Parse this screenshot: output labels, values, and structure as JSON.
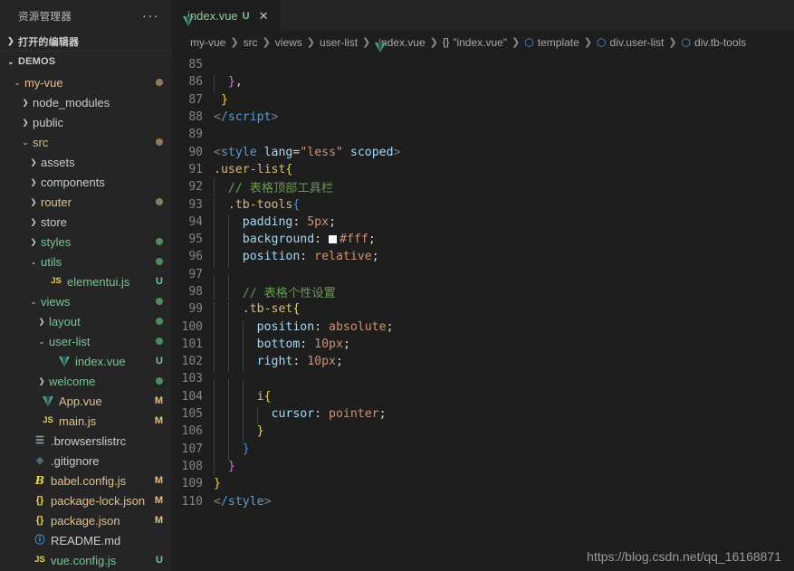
{
  "sidebar": {
    "title": "资源管理器",
    "more_label": "···",
    "sections": [
      {
        "label": "打开的编辑器",
        "expanded": false
      },
      {
        "label": "DEMOS",
        "expanded": true
      }
    ],
    "tree": [
      {
        "indent": 1,
        "chev": "v",
        "icon": "folder",
        "label": "my-vue",
        "badge": "",
        "dot": "modified",
        "color": "modified"
      },
      {
        "indent": 2,
        "chev": ">",
        "icon": "folder",
        "label": "node_modules",
        "badge": "",
        "dot": "",
        "color": "plain"
      },
      {
        "indent": 2,
        "chev": ">",
        "icon": "folder",
        "label": "public",
        "badge": "",
        "dot": "",
        "color": "plain"
      },
      {
        "indent": 2,
        "chev": "v",
        "icon": "folder",
        "label": "src",
        "badge": "",
        "dot": "modified",
        "color": "modified"
      },
      {
        "indent": 3,
        "chev": ">",
        "icon": "folder",
        "label": "assets",
        "badge": "",
        "dot": "",
        "color": "plain"
      },
      {
        "indent": 3,
        "chev": ">",
        "icon": "folder",
        "label": "components",
        "badge": "",
        "dot": "",
        "color": "plain"
      },
      {
        "indent": 3,
        "chev": ">",
        "icon": "folder",
        "label": "router",
        "badge": "",
        "dot": "modified",
        "color": "modified"
      },
      {
        "indent": 3,
        "chev": ">",
        "icon": "folder",
        "label": "store",
        "badge": "",
        "dot": "",
        "color": "plain"
      },
      {
        "indent": 3,
        "chev": ">",
        "icon": "folder",
        "label": "styles",
        "badge": "",
        "dot": "untracked",
        "color": "untracked"
      },
      {
        "indent": 3,
        "chev": "v",
        "icon": "folder",
        "label": "utils",
        "badge": "",
        "dot": "untracked",
        "color": "untracked"
      },
      {
        "indent": 4,
        "chev": "",
        "icon": "js",
        "label": "elementui.js",
        "badge": "U",
        "dot": "",
        "color": "untracked"
      },
      {
        "indent": 3,
        "chev": "v",
        "icon": "folder",
        "label": "views",
        "badge": "",
        "dot": "untracked",
        "color": "untracked"
      },
      {
        "indent": 4,
        "chev": ">",
        "icon": "folder",
        "label": "layout",
        "badge": "",
        "dot": "untracked",
        "color": "untracked"
      },
      {
        "indent": 4,
        "chev": "v",
        "icon": "folder",
        "label": "user-list",
        "badge": "",
        "dot": "untracked",
        "color": "untracked"
      },
      {
        "indent": 5,
        "chev": "",
        "icon": "vue",
        "label": "index.vue",
        "badge": "U",
        "dot": "",
        "color": "untracked"
      },
      {
        "indent": 4,
        "chev": ">",
        "icon": "folder",
        "label": "welcome",
        "badge": "",
        "dot": "untracked",
        "color": "untracked"
      },
      {
        "indent": 3,
        "chev": "",
        "icon": "vue",
        "label": "App.vue",
        "badge": "M",
        "dot": "",
        "color": "modified"
      },
      {
        "indent": 3,
        "chev": "",
        "icon": "js",
        "label": "main.js",
        "badge": "M",
        "dot": "",
        "color": "modified"
      },
      {
        "indent": 2,
        "chev": "",
        "icon": "list",
        "label": ".browserslistrc",
        "badge": "",
        "dot": "",
        "color": "plain"
      },
      {
        "indent": 2,
        "chev": "",
        "icon": "git",
        "label": ".gitignore",
        "badge": "",
        "dot": "",
        "color": "plain"
      },
      {
        "indent": 2,
        "chev": "",
        "icon": "babel",
        "label": "babel.config.js",
        "badge": "M",
        "dot": "",
        "color": "modified"
      },
      {
        "indent": 2,
        "chev": "",
        "icon": "json",
        "label": "package-lock.json",
        "badge": "M",
        "dot": "",
        "color": "modified"
      },
      {
        "indent": 2,
        "chev": "",
        "icon": "json",
        "label": "package.json",
        "badge": "M",
        "dot": "",
        "color": "modified"
      },
      {
        "indent": 2,
        "chev": "",
        "icon": "info",
        "label": "README.md",
        "badge": "",
        "dot": "",
        "color": "plain"
      },
      {
        "indent": 2,
        "chev": "",
        "icon": "js",
        "label": "vue.config.js",
        "badge": "U",
        "dot": "",
        "color": "untracked"
      }
    ]
  },
  "tab": {
    "icon": "vue-icon",
    "label": "index.vue",
    "status_badge": "U",
    "close_label": "✕"
  },
  "breadcrumb": [
    {
      "text": "my-vue",
      "icon": ""
    },
    {
      "text": "src",
      "icon": ""
    },
    {
      "text": "views",
      "icon": ""
    },
    {
      "text": "user-list",
      "icon": ""
    },
    {
      "text": "index.vue",
      "icon": "vue"
    },
    {
      "text": "\"index.vue\"",
      "icon": "braces"
    },
    {
      "text": "template",
      "icon": "cube"
    },
    {
      "text": "div.user-list",
      "icon": "cube"
    },
    {
      "text": "div.tb-tools",
      "icon": "cube"
    }
  ],
  "editor": {
    "first_line": 85,
    "lines": [
      {
        "n": 85,
        "indent": 0,
        "guides": [],
        "tokens": []
      },
      {
        "n": 86,
        "indent": 0,
        "guides": [
          1
        ],
        "tokens": [
          {
            "t": "  ",
            "c": "t-punc"
          },
          {
            "t": "}",
            "c": "b2"
          },
          {
            "t": ",",
            "c": "t-punc"
          }
        ]
      },
      {
        "n": 87,
        "indent": 0,
        "guides": [],
        "tokens": [
          {
            "t": " ",
            "c": "t-punc"
          },
          {
            "t": "}",
            "c": "b1"
          }
        ]
      },
      {
        "n": 88,
        "indent": 0,
        "guides": [],
        "tokens": [
          {
            "t": "<",
            "c": "t-brk"
          },
          {
            "t": "/script",
            "c": "t-tag"
          },
          {
            "t": ">",
            "c": "t-brk"
          }
        ]
      },
      {
        "n": 89,
        "indent": 0,
        "guides": [],
        "tokens": []
      },
      {
        "n": 90,
        "indent": 0,
        "guides": [],
        "tokens": [
          {
            "t": "<",
            "c": "t-brk"
          },
          {
            "t": "style",
            "c": "t-tag"
          },
          {
            "t": " ",
            "c": "t-punc"
          },
          {
            "t": "lang",
            "c": "t-attr"
          },
          {
            "t": "=",
            "c": "t-punc"
          },
          {
            "t": "\"less\"",
            "c": "t-str"
          },
          {
            "t": " ",
            "c": "t-punc"
          },
          {
            "t": "scoped",
            "c": "t-attr"
          },
          {
            "t": ">",
            "c": "t-brk"
          }
        ]
      },
      {
        "n": 91,
        "indent": 0,
        "guides": [],
        "tokens": [
          {
            "t": ".user-list",
            "c": "t-sel"
          },
          {
            "t": "{",
            "c": "b1"
          }
        ]
      },
      {
        "n": 92,
        "indent": 0,
        "guides": [
          1
        ],
        "tokens": [
          {
            "t": "  // 表格顶部工具栏",
            "c": "t-com"
          }
        ]
      },
      {
        "n": 93,
        "indent": 0,
        "guides": [
          1
        ],
        "tokens": [
          {
            "t": "  .tb-tools",
            "c": "t-sel"
          },
          {
            "t": "{",
            "c": "b3"
          }
        ]
      },
      {
        "n": 94,
        "indent": 0,
        "guides": [
          1,
          2
        ],
        "tokens": [
          {
            "t": "    padding",
            "c": "t-prop"
          },
          {
            "t": ": ",
            "c": "t-punc"
          },
          {
            "t": "5px",
            "c": "t-val"
          },
          {
            "t": ";",
            "c": "t-punc"
          }
        ]
      },
      {
        "n": 95,
        "indent": 0,
        "guides": [
          1,
          2
        ],
        "tokens": [
          {
            "t": "    background",
            "c": "t-prop"
          },
          {
            "t": ": ",
            "c": "t-punc"
          },
          {
            "t": "§#fff",
            "c": "t-val"
          },
          {
            "t": ";",
            "c": "t-punc"
          }
        ]
      },
      {
        "n": 96,
        "indent": 0,
        "guides": [
          1,
          2
        ],
        "tokens": [
          {
            "t": "    position",
            "c": "t-prop"
          },
          {
            "t": ": ",
            "c": "t-punc"
          },
          {
            "t": "relative",
            "c": "t-val"
          },
          {
            "t": ";",
            "c": "t-punc"
          }
        ]
      },
      {
        "n": 97,
        "indent": 0,
        "guides": [
          1,
          2
        ],
        "tokens": []
      },
      {
        "n": 98,
        "indent": 0,
        "guides": [
          1,
          2
        ],
        "tokens": [
          {
            "t": "    // 表格个性设置",
            "c": "t-com"
          }
        ]
      },
      {
        "n": 99,
        "indent": 0,
        "guides": [
          1,
          2
        ],
        "tokens": [
          {
            "t": "    .tb-set",
            "c": "t-sel"
          },
          {
            "t": "{",
            "c": "b1"
          }
        ]
      },
      {
        "n": 100,
        "indent": 0,
        "guides": [
          1,
          2,
          3
        ],
        "tokens": [
          {
            "t": "      position",
            "c": "t-prop"
          },
          {
            "t": ": ",
            "c": "t-punc"
          },
          {
            "t": "absolute",
            "c": "t-val"
          },
          {
            "t": ";",
            "c": "t-punc"
          }
        ]
      },
      {
        "n": 101,
        "indent": 0,
        "guides": [
          1,
          2,
          3
        ],
        "tokens": [
          {
            "t": "      bottom",
            "c": "t-prop"
          },
          {
            "t": ": ",
            "c": "t-punc"
          },
          {
            "t": "10px",
            "c": "t-val"
          },
          {
            "t": ";",
            "c": "t-punc"
          }
        ]
      },
      {
        "n": 102,
        "indent": 0,
        "guides": [
          1,
          2,
          3
        ],
        "tokens": [
          {
            "t": "      right",
            "c": "t-prop"
          },
          {
            "t": ": ",
            "c": "t-punc"
          },
          {
            "t": "10px",
            "c": "t-val"
          },
          {
            "t": ";",
            "c": "t-punc"
          }
        ]
      },
      {
        "n": 103,
        "indent": 0,
        "guides": [
          1,
          2,
          3
        ],
        "tokens": []
      },
      {
        "n": 104,
        "indent": 0,
        "guides": [
          1,
          2,
          3
        ],
        "tokens": [
          {
            "t": "      i",
            "c": "t-sel"
          },
          {
            "t": "{",
            "c": "b1"
          }
        ]
      },
      {
        "n": 105,
        "indent": 0,
        "guides": [
          1,
          2,
          3,
          4
        ],
        "tokens": [
          {
            "t": "        cursor",
            "c": "t-prop"
          },
          {
            "t": ": ",
            "c": "t-punc"
          },
          {
            "t": "pointer",
            "c": "t-val"
          },
          {
            "t": ";",
            "c": "t-punc"
          }
        ]
      },
      {
        "n": 106,
        "indent": 0,
        "guides": [
          1,
          2,
          3
        ],
        "tokens": [
          {
            "t": "      ",
            "c": "t-punc"
          },
          {
            "t": "}",
            "c": "b1"
          }
        ]
      },
      {
        "n": 107,
        "indent": 0,
        "guides": [
          1,
          2
        ],
        "tokens": [
          {
            "t": "    ",
            "c": "t-punc"
          },
          {
            "t": "}",
            "c": "b3"
          }
        ]
      },
      {
        "n": 108,
        "indent": 0,
        "guides": [
          1
        ],
        "tokens": [
          {
            "t": "  ",
            "c": "t-punc"
          },
          {
            "t": "}",
            "c": "b2"
          }
        ]
      },
      {
        "n": 109,
        "indent": 0,
        "guides": [],
        "tokens": [
          {
            "t": "}",
            "c": "b1"
          }
        ]
      },
      {
        "n": 110,
        "indent": 0,
        "guides": [],
        "tokens": [
          {
            "t": "<",
            "c": "t-brk"
          },
          {
            "t": "/style",
            "c": "t-tag"
          },
          {
            "t": ">",
            "c": "t-brk"
          }
        ]
      }
    ]
  },
  "watermark": "https://blog.csdn.net/qq_16168871",
  "colors": {
    "editor_bg": "#1e1e1e",
    "sidebar_bg": "#252526",
    "modified": "#e2c08d",
    "untracked": "#73c991",
    "vue_green": "#41b883",
    "accent_blue": "#4a9ae8"
  }
}
